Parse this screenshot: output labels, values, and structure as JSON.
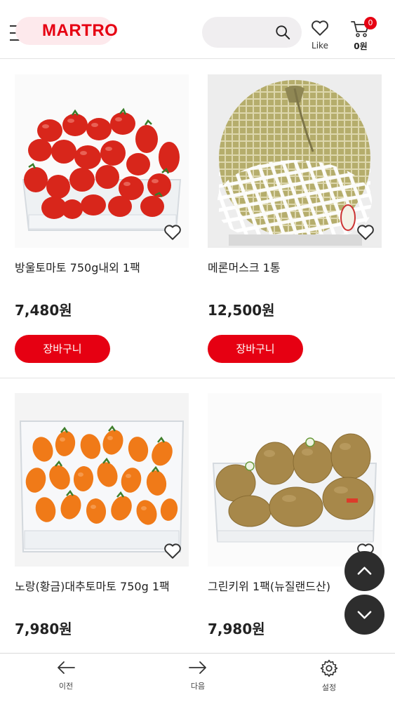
{
  "header": {
    "logo": "MARTRO",
    "like_label": "Like",
    "cart_count": "0",
    "cart_amount": "0원"
  },
  "products": [
    {
      "name": "방울토마토 750g내외 1팩",
      "price": "7,480원",
      "cart_label": "장바구니"
    },
    {
      "name": "메론머스크 1통",
      "price": "12,500원",
      "cart_label": "장바구니"
    },
    {
      "name": "노랑(황금)대추토마토 750g 1팩",
      "price": "7,980원"
    },
    {
      "name": "그린키위 1팩(뉴질랜드산)",
      "price": "7,980원"
    }
  ],
  "bottom_nav": {
    "prev_label": "이전",
    "next_label": "다음",
    "settings_label": "설정"
  },
  "icons": [
    "menu-icon",
    "search-icon",
    "heart-icon",
    "cart-icon",
    "chevron-up-icon",
    "chevron-down-icon",
    "arrow-left-icon",
    "arrow-right-icon",
    "gear-icon"
  ],
  "colors": {
    "brand": "#e60012",
    "fab": "#2d2d2d"
  }
}
